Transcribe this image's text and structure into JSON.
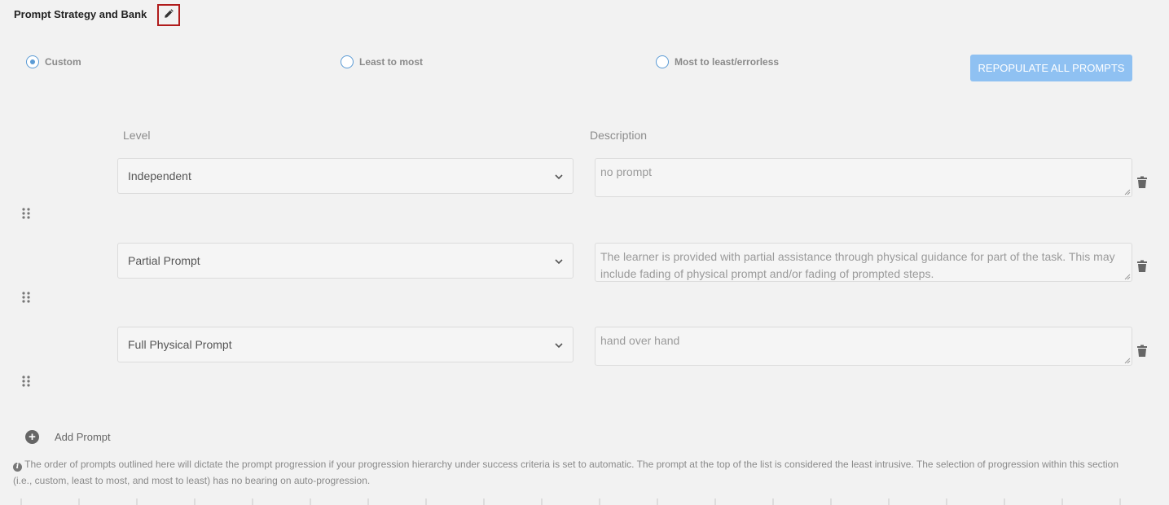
{
  "section": {
    "title": "Prompt Strategy and Bank"
  },
  "strategy": {
    "options": [
      {
        "label": "Custom",
        "checked": true
      },
      {
        "label": "Least to most",
        "checked": false
      },
      {
        "label": "Most to least/errorless",
        "checked": false
      }
    ],
    "repopulate_label": "REPOPULATE ALL PROMPTS"
  },
  "columns": {
    "level": "Level",
    "description": "Description"
  },
  "prompts": [
    {
      "level": "Independent",
      "description": "no prompt"
    },
    {
      "level": "Partial Prompt",
      "description": "The learner is provided with partial assistance through physical guidance for part of the task. This may include fading of physical prompt and/or fading of prompted steps."
    },
    {
      "level": "Full Physical Prompt",
      "description": "hand over hand"
    }
  ],
  "add_prompt_label": "Add Prompt",
  "info_text": "The order of prompts outlined here will dictate the prompt progression if your progression hierarchy under success criteria is set to automatic. The prompt at the top of the list is considered the least intrusive. The selection of progression within this section (i.e., custom, least to most, and most to least) has no bearing on auto-progression.",
  "colors": {
    "accent": "#5b9bd5",
    "button": "#8fc1f2",
    "edit_highlight": "#b01c1c"
  },
  "icons": [
    "pencil-icon",
    "trash-icon",
    "drag-handle-icon",
    "plus-circle-icon",
    "info-icon",
    "chevron-down-icon"
  ]
}
